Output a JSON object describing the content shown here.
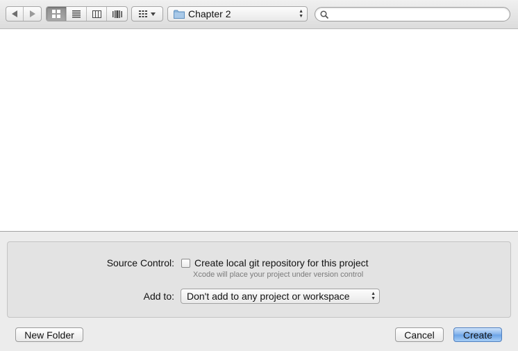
{
  "toolbar": {
    "nav": {
      "back_icon": "triangle-left",
      "forward_icon": "triangle-right"
    },
    "view_modes": [
      {
        "name": "icon-view",
        "active": true
      },
      {
        "name": "list-view",
        "active": false
      },
      {
        "name": "column-view",
        "active": false
      },
      {
        "name": "cover-flow-view",
        "active": false
      }
    ],
    "arrange_icon": "grid-icon",
    "path_popup": {
      "icon": "folder-icon",
      "label": "Chapter 2"
    },
    "search": {
      "icon": "search-icon",
      "value": "",
      "placeholder": ""
    }
  },
  "accessory": {
    "source_control_label": "Source Control:",
    "git_checkbox_label": "Create local git repository for this project",
    "git_checkbox_checked": false,
    "git_hint": "Xcode will place your project under version control",
    "add_to_label": "Add to:",
    "add_to_value": "Don't add to any project or workspace"
  },
  "buttons": {
    "new_folder": "New Folder",
    "cancel": "Cancel",
    "create": "Create"
  },
  "colors": {
    "default_button": "#7fb0ea",
    "window_bg": "#ececec",
    "browser_bg": "#ffffff"
  }
}
